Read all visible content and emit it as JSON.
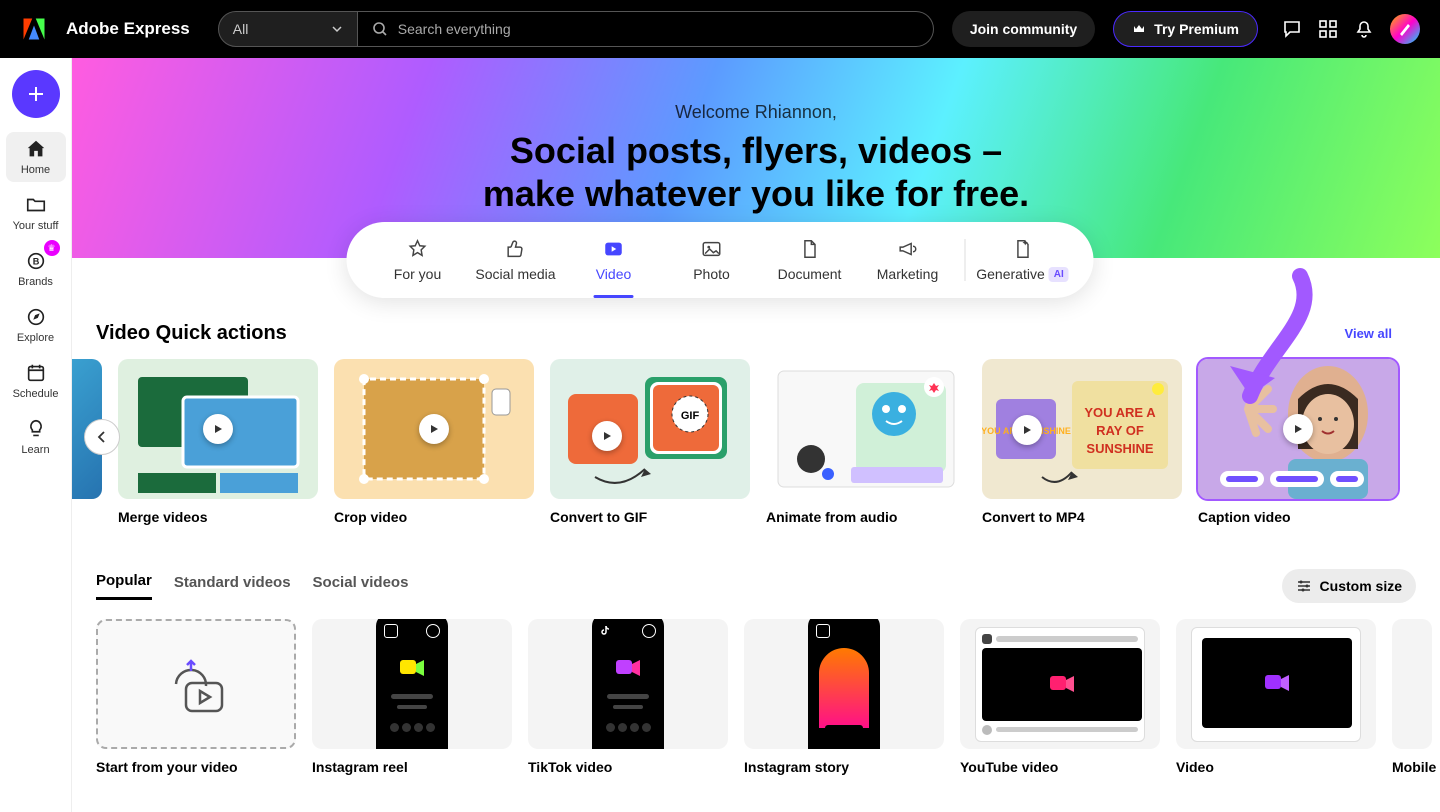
{
  "header": {
    "app_title": "Adobe Express",
    "search_dropdown": "All",
    "search_placeholder": "Search everything",
    "join_community": "Join community",
    "try_premium": "Try Premium"
  },
  "sidebar": {
    "items": [
      "Home",
      "Your stuff",
      "Brands",
      "Explore",
      "Schedule",
      "Learn"
    ]
  },
  "hero": {
    "welcome": "Welcome Rhiannon,",
    "title_line1": "Social posts, flyers, videos –",
    "title_line2": "make whatever you like for free."
  },
  "categories": [
    "For you",
    "Social media",
    "Video",
    "Photo",
    "Document",
    "Marketing",
    "Generative"
  ],
  "ai_badge": "AI",
  "section1": {
    "title": "Video Quick actions",
    "view_all": "View all",
    "cards": [
      "Merge videos",
      "Crop video",
      "Convert to GIF",
      "Animate from audio",
      "Convert to MP4",
      "Caption video"
    ]
  },
  "tabs": [
    "Popular",
    "Standard videos",
    "Social videos"
  ],
  "custom_size": "Custom size",
  "templates": [
    "Start from your video",
    "Instagram reel",
    "TikTok video",
    "Instagram story",
    "YouTube video",
    "Video",
    "Mobile vid"
  ]
}
